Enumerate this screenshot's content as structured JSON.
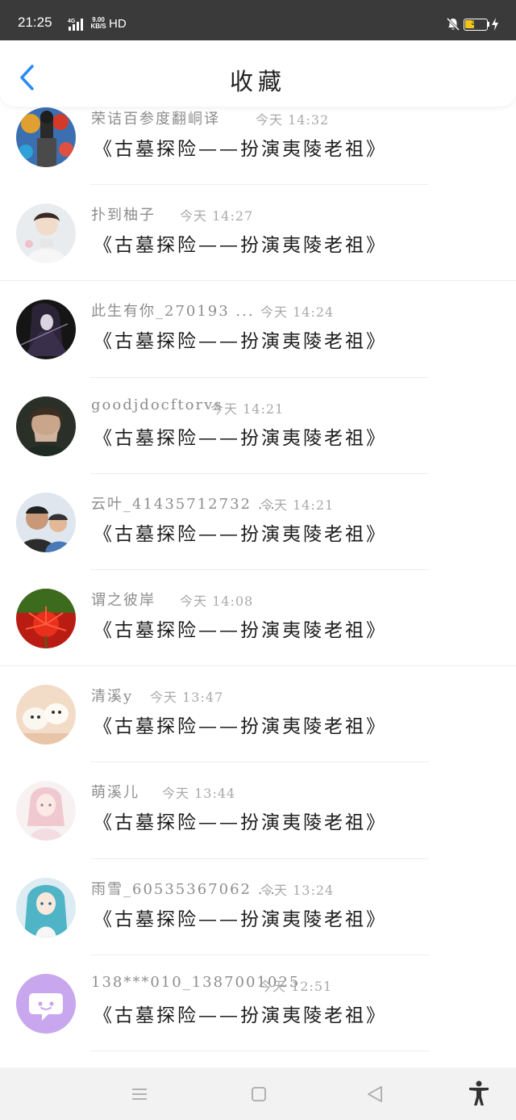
{
  "status_bar": {
    "time": "21:25",
    "network": "4G",
    "speed_value": "9.00",
    "speed_unit": "KB/S",
    "hd": "HD",
    "battery": "39"
  },
  "header": {
    "title": "收藏",
    "back_icon": "chevron-left-icon"
  },
  "colors": {
    "accent": "#2a8bf2",
    "battery": "#f5c518",
    "status_bar": "#3a3a3a"
  },
  "items": [
    {
      "name": "荣诘百参度翻峒译",
      "time": "今天 14:32",
      "book": "《古墓探险——扮演夷陵老祖》",
      "avatar": "avatar-photo"
    },
    {
      "name": "扑到柚子",
      "time": "今天 14:27",
      "book": "《古墓探险——扮演夷陵老祖》",
      "avatar": "avatar-photo"
    },
    {
      "name": "此生有你_270193 ...",
      "time": "今天 14:24",
      "book": "《古墓探险——扮演夷陵老祖》",
      "avatar": "avatar-photo"
    },
    {
      "name": "goodjdocftorvs",
      "time": "今天 14:21",
      "book": "《古墓探险——扮演夷陵老祖》",
      "avatar": "avatar-photo"
    },
    {
      "name": "云叶_41435712732 ...",
      "time": "今天 14:21",
      "book": "《古墓探险——扮演夷陵老祖》",
      "avatar": "avatar-photo"
    },
    {
      "name": "谓之彼岸",
      "time": "今天 14:08",
      "book": "《古墓探险——扮演夷陵老祖》",
      "avatar": "avatar-photo"
    },
    {
      "name": "清溪y",
      "time": "今天 13:47",
      "book": "《古墓探险——扮演夷陵老祖》",
      "avatar": "avatar-photo"
    },
    {
      "name": "萌溪儿",
      "time": "今天 13:44",
      "book": "《古墓探险——扮演夷陵老祖》",
      "avatar": "avatar-photo"
    },
    {
      "name": "雨雪_60535367062 ...",
      "time": "今天 13:24",
      "book": "《古墓探险——扮演夷陵老祖》",
      "avatar": "avatar-photo"
    },
    {
      "name": "138***010_1387001025",
      "time": "今天 12:51",
      "book": "《古墓探险——扮演夷陵老祖》",
      "avatar": "default-chat-avatar-icon"
    }
  ],
  "nav_bar": {
    "menu_icon": "menu-icon",
    "home_icon": "home-square-icon",
    "back_icon": "back-triangle-icon",
    "accessibility_icon": "accessibility-icon"
  }
}
